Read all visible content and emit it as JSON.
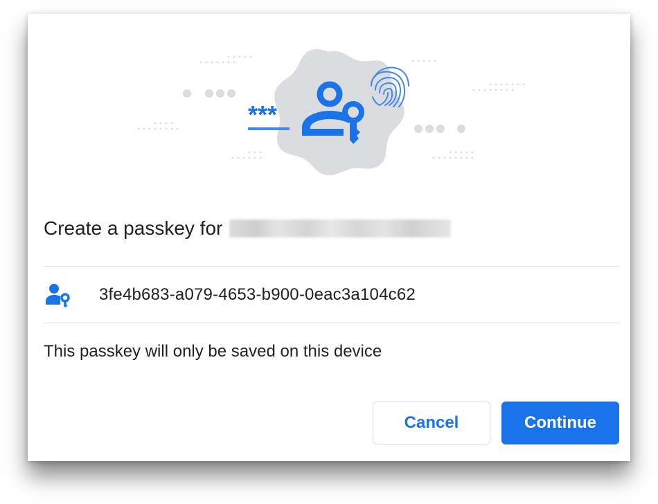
{
  "dialog": {
    "title_prefix": "Create a passkey for",
    "account_id": "3fe4b683-a079-4653-b900-0eac3a104c62",
    "info": "This passkey will only be saved on this device",
    "cancel_label": "Cancel",
    "continue_label": "Continue"
  },
  "icons": {
    "hero": "passkey-illustration",
    "account": "person-key-icon",
    "fingerprint": "fingerprint-icon",
    "password": "password-asterisks-icon"
  },
  "colors": {
    "accent": "#1a73e8",
    "badge": "#dadce0",
    "text": "#202124"
  }
}
